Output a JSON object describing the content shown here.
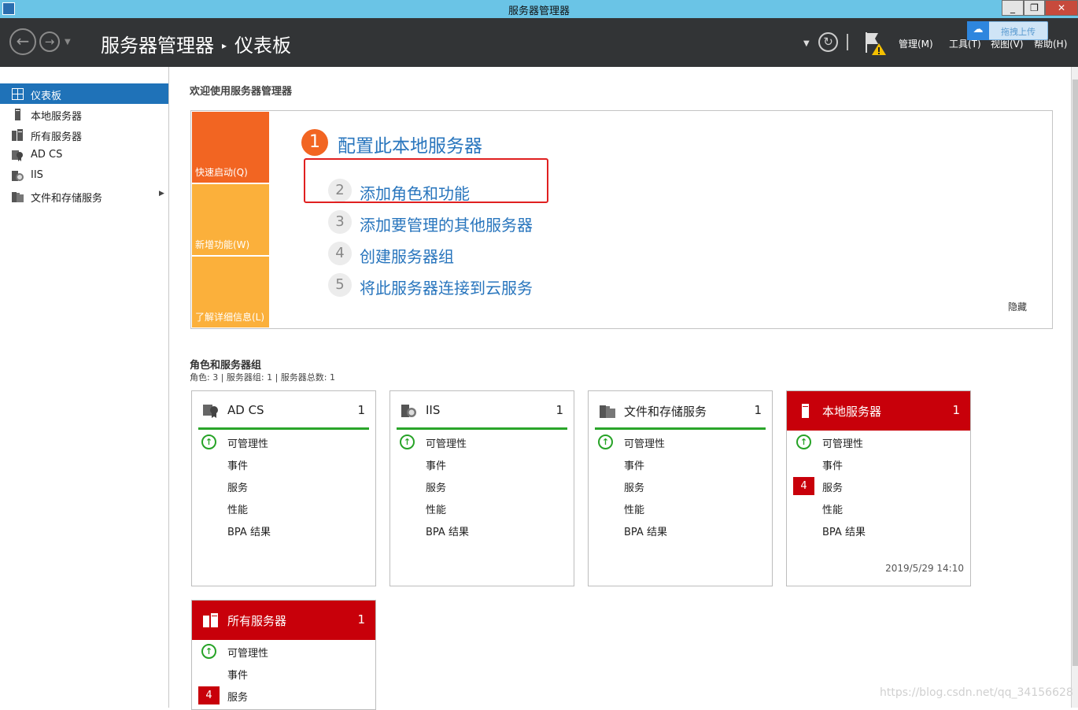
{
  "window": {
    "title": "服务器管理器",
    "buttons": [
      "_",
      "❐",
      "✕"
    ]
  },
  "header": {
    "breadcrumb": [
      "服务器管理器",
      "仪表板"
    ],
    "menus": [
      "管理(M)",
      "工具(T)",
      "视图(V)",
      "帮助(H)"
    ],
    "upload_label": "拖拽上传"
  },
  "sidebar": {
    "items": [
      {
        "label": "仪表板",
        "icon": "dashboard-icon",
        "active": true
      },
      {
        "label": "本地服务器",
        "icon": "server-icon"
      },
      {
        "label": "所有服务器",
        "icon": "servers-icon"
      },
      {
        "label": "AD CS",
        "icon": "certificate-icon"
      },
      {
        "label": "IIS",
        "icon": "iis-icon"
      },
      {
        "label": "文件和存储服务",
        "icon": "file-storage-icon",
        "has_arrow": true
      }
    ]
  },
  "welcome": {
    "title": "欢迎使用服务器管理器",
    "tabs": [
      "快速启动(Q)",
      "新增功能(W)",
      "了解详细信息(L)"
    ],
    "steps": [
      {
        "num": "1",
        "label": "配置此本地服务器"
      },
      {
        "num": "2",
        "label": "添加角色和功能"
      },
      {
        "num": "3",
        "label": "添加要管理的其他服务器"
      },
      {
        "num": "4",
        "label": "创建服务器组"
      },
      {
        "num": "5",
        "label": "将此服务器连接到云服务"
      }
    ],
    "hide_label": "隐藏"
  },
  "roles": {
    "title": "角色和服务器组",
    "subtitle": "角色: 3 | 服务器组: 1 | 服务器总数: 1",
    "rows": [
      "可管理性",
      "事件",
      "服务",
      "性能",
      "BPA 结果"
    ],
    "cards": [
      {
        "title": "AD CS",
        "count": "1",
        "icon": "certificate-icon",
        "alert": false
      },
      {
        "title": "IIS",
        "count": "1",
        "icon": "iis-icon",
        "alert": false
      },
      {
        "title": "文件和存储服务",
        "count": "1",
        "icon": "file-storage-icon",
        "alert": false
      },
      {
        "title": "本地服务器",
        "count": "1",
        "icon": "server-icon",
        "alert": true,
        "services_badge": "4",
        "timestamp": "2019/5/29 14:10"
      },
      {
        "title": "所有服务器",
        "count": "1",
        "icon": "servers-icon",
        "alert": true,
        "services_badge": "4"
      }
    ]
  },
  "watermark": "https://blog.csdn.net/qq_34156628",
  "colors": {
    "accent": "#1f72b8",
    "alert": "#c8000a",
    "ok": "#27a327",
    "orange": "#f26522",
    "amber": "#fbb03b"
  }
}
